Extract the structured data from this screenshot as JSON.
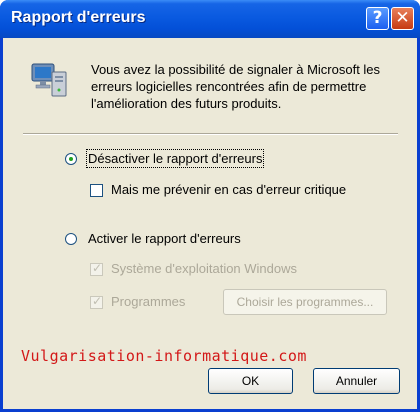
{
  "window": {
    "title": "Rapport d'erreurs",
    "help_label": "?",
    "close_label": "✕"
  },
  "info": {
    "icon": "computer-monitor-icon",
    "text": "Vous avez la possibilité de signaler à Microsoft les erreurs logicielles rencontrées afin de permettre l'amélioration des futurs produits."
  },
  "options": {
    "disable": {
      "label": "Désactiver le rapport d'erreurs",
      "selected": true
    },
    "notify_critical": {
      "label": "Mais me prévenir en cas d'erreur critique",
      "checked": false
    },
    "enable": {
      "label": "Activer le rapport d'erreurs",
      "selected": false
    },
    "os": {
      "label": "Système d'exploitation Windows",
      "checked": true,
      "disabled": true
    },
    "programs": {
      "label": "Programmes",
      "checked": true,
      "disabled": true
    },
    "choose_programs": {
      "label": "Choisir les programmes...",
      "disabled": true
    }
  },
  "buttons": {
    "ok": "OK",
    "cancel": "Annuler"
  },
  "watermark": "Vulgarisation-informatique.com",
  "colors": {
    "titlebar": "#0a5ae0",
    "dialog_bg": "#ece9d8",
    "radio_dot": "#21a121",
    "disabled_text": "#aca899",
    "watermark": "#d31818"
  }
}
